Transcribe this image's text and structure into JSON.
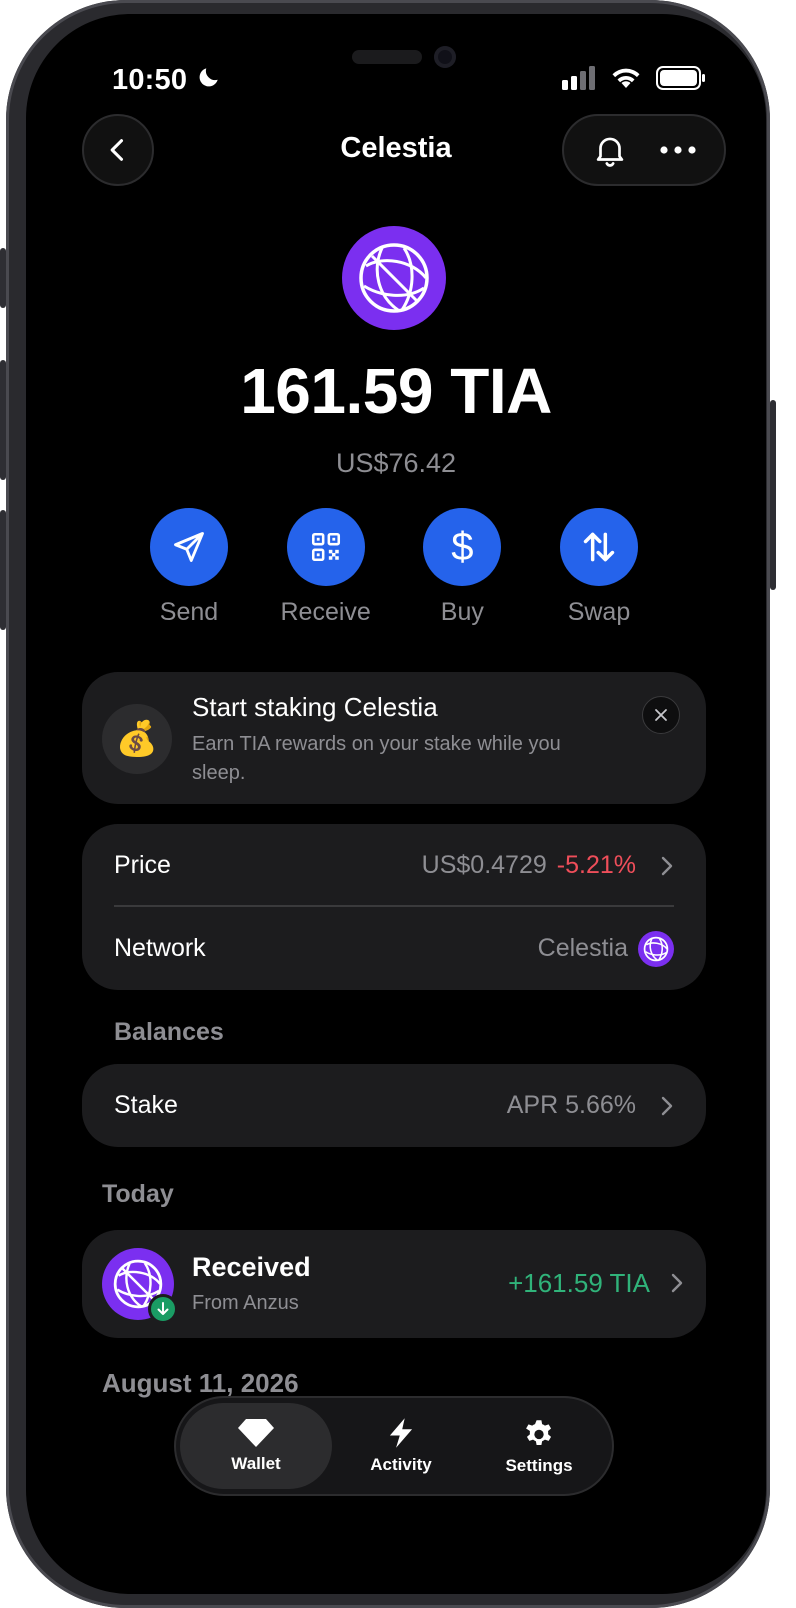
{
  "status_bar": {
    "time": "10:50"
  },
  "nav": {
    "title": "Celestia"
  },
  "asset": {
    "amount": "161.59 TIA",
    "fiat_value": "US$76.42"
  },
  "actions": [
    {
      "label": "Send",
      "icon": "send-icon"
    },
    {
      "label": "Receive",
      "icon": "qr-code-icon"
    },
    {
      "label": "Buy",
      "icon": "dollar-icon"
    },
    {
      "label": "Swap",
      "icon": "swap-arrows-icon"
    }
  ],
  "promo": {
    "title": "Start staking Celestia",
    "subtitle": "Earn TIA rewards on your stake while you sleep.",
    "icon": "money-bag-icon"
  },
  "info": {
    "price_label": "Price",
    "price_value": "US$0.4729",
    "price_change": "-5.21%",
    "network_label": "Network",
    "network_value": "Celestia"
  },
  "balances": {
    "header": "Balances",
    "stake_label": "Stake",
    "stake_value": "APR 5.66%"
  },
  "activity": {
    "today_header": "Today",
    "tx_title": "Received",
    "tx_subtitle": "From Anzus",
    "tx_amount": "+161.59 TIA",
    "next_date_header": "August 11, 2026"
  },
  "tabs": [
    {
      "label": "Wallet",
      "icon": "diamond-icon",
      "active": true
    },
    {
      "label": "Activity",
      "icon": "lightning-icon",
      "active": false
    },
    {
      "label": "Settings",
      "icon": "gear-icon",
      "active": false
    }
  ],
  "colors": {
    "accent": "#2563eb",
    "negative": "#ef4e5a",
    "positive": "#30b37a",
    "celestia_purple": "#7b2ff0"
  }
}
